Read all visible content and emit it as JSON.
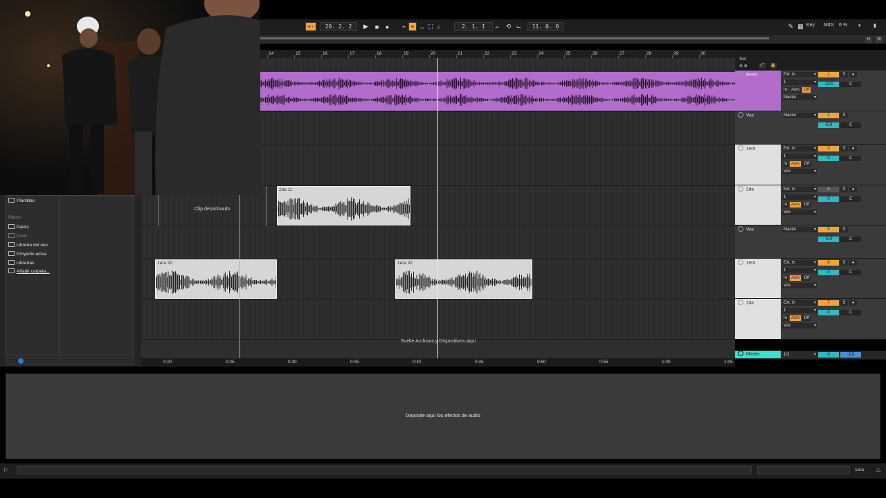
{
  "transport": {
    "position": "20.  2.  2",
    "loop_start": "2.  1.  1",
    "loop_length": "11.  0.  0",
    "key_label": "Key",
    "midi_label": "MIDI",
    "cpu": "6 %"
  },
  "overview": {
    "h": "H",
    "w": "W"
  },
  "ruler": {
    "bars": [
      "14",
      "15",
      "16",
      "17",
      "18",
      "19",
      "20",
      "21",
      "22",
      "23",
      "24",
      "25",
      "26",
      "27",
      "28",
      "29",
      "30"
    ]
  },
  "set_label": "Set",
  "clips": {
    "desactivado": "Clip desactivado",
    "c2da": "2da 11",
    "c1era_a": "1era 32",
    "c1era_b": "1era 32"
  },
  "drop_hint": "Suelte Archivos y Dispositivos aquí",
  "time_ruler": [
    "0:20",
    "0:25",
    "0:30",
    "0:35",
    "0:40",
    "0:45",
    "0:50",
    "0:55",
    "1:00",
    "1:05"
  ],
  "tracks": [
    {
      "name": "Beats",
      "input": "Ext. In",
      "channel": "1",
      "mon": [
        "In",
        "Auto",
        "Off"
      ],
      "mon_on": "Off",
      "output": "Master",
      "num": "1",
      "vol": "-10.0",
      "pan": "C",
      "color": "#b26ccc"
    },
    {
      "name": "Vox",
      "input": "",
      "channel": "",
      "mon": [],
      "mon_on": "",
      "output": "Master",
      "num": "2",
      "vol": "-5.0",
      "pan": "C"
    },
    {
      "name": "1era",
      "input": "Ext. In",
      "channel": "1",
      "mon": [
        "In",
        "Auto",
        "Off"
      ],
      "mon_on": "Auto",
      "output": "Vox",
      "num": "3",
      "vol": "0",
      "pan": "C"
    },
    {
      "name": "2da",
      "input": "Ext. In",
      "channel": "1",
      "mon": [
        "In",
        "Auto",
        "Off"
      ],
      "mon_on": "Auto",
      "output": "Vox",
      "num": "4",
      "vol": "0",
      "pan": "C"
    },
    {
      "name": "Vox",
      "input": "",
      "channel": "",
      "mon": [],
      "mon_on": "",
      "output": "Master",
      "num": "5",
      "vol": "-5.0",
      "pan": "C"
    },
    {
      "name": "1era",
      "input": "Ext. In",
      "channel": "1",
      "mon": [
        "In",
        "Auto",
        "Off"
      ],
      "mon_on": "Auto",
      "output": "Vox",
      "num": "6",
      "vol": "0",
      "pan": "C"
    },
    {
      "name": "2da",
      "input": "Ext. In",
      "channel": "1",
      "mon": [
        "In",
        "Auto",
        "Off"
      ],
      "mon_on": "Auto",
      "output": "Vox",
      "num": "7",
      "vol": "0",
      "pan": "C"
    }
  ],
  "master": {
    "name": "Master",
    "output": "1/2",
    "vol": "0",
    "pan": "-2.0"
  },
  "browser": {
    "templates": "Plantillas",
    "places_header": "Places",
    "packs": "Packs",
    "push": "Push",
    "user_library": "Librería del usu",
    "current_project": "Proyecto actua",
    "libraries": "Librerías",
    "add_folder": "Añadir carpeta..."
  },
  "device_hint": "Deposite aquí los efectos de audio",
  "status": {
    "selected_track": "1era"
  }
}
